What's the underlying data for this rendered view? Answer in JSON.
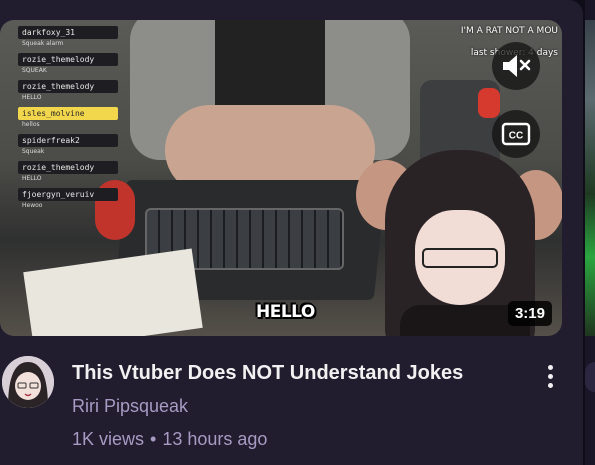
{
  "video": {
    "title": "This Vtuber Does NOT Understand Jokes",
    "channel": "Riri Pipsqueak",
    "views": "1K views",
    "separator": "•",
    "age": "13 hours ago",
    "duration": "3:19"
  },
  "thumbnail": {
    "overlay_line1": "I'M A RAT NOT A MOU",
    "overlay_line2": "last shower: 4 days",
    "caption": "HELLO",
    "chat": [
      {
        "name": "darkfoxy_31",
        "msg": "Squeak alarm",
        "highlight": false
      },
      {
        "name": "rozie_themelody",
        "msg": "SQUEAK",
        "highlight": false
      },
      {
        "name": "rozie_themelody",
        "msg": "HELLO",
        "highlight": false
      },
      {
        "name": "isles_molvine",
        "msg": "hellos",
        "highlight": true
      },
      {
        "name": "spiderfreak2",
        "msg": "Squeak",
        "highlight": false
      },
      {
        "name": "rozie_themelody",
        "msg": "HELLO",
        "highlight": false
      },
      {
        "name": "fjoergyn_veruiv",
        "msg": "Hewoo",
        "highlight": false
      }
    ]
  },
  "icons": {
    "mute": "speaker-muted-icon",
    "captions": "closed-captions-icon",
    "menu": "kebab-menu-icon"
  },
  "colors": {
    "card_bg": "#211c2e",
    "secondary_text": "#a79bc4",
    "chat_highlight": "#f2d64b"
  }
}
